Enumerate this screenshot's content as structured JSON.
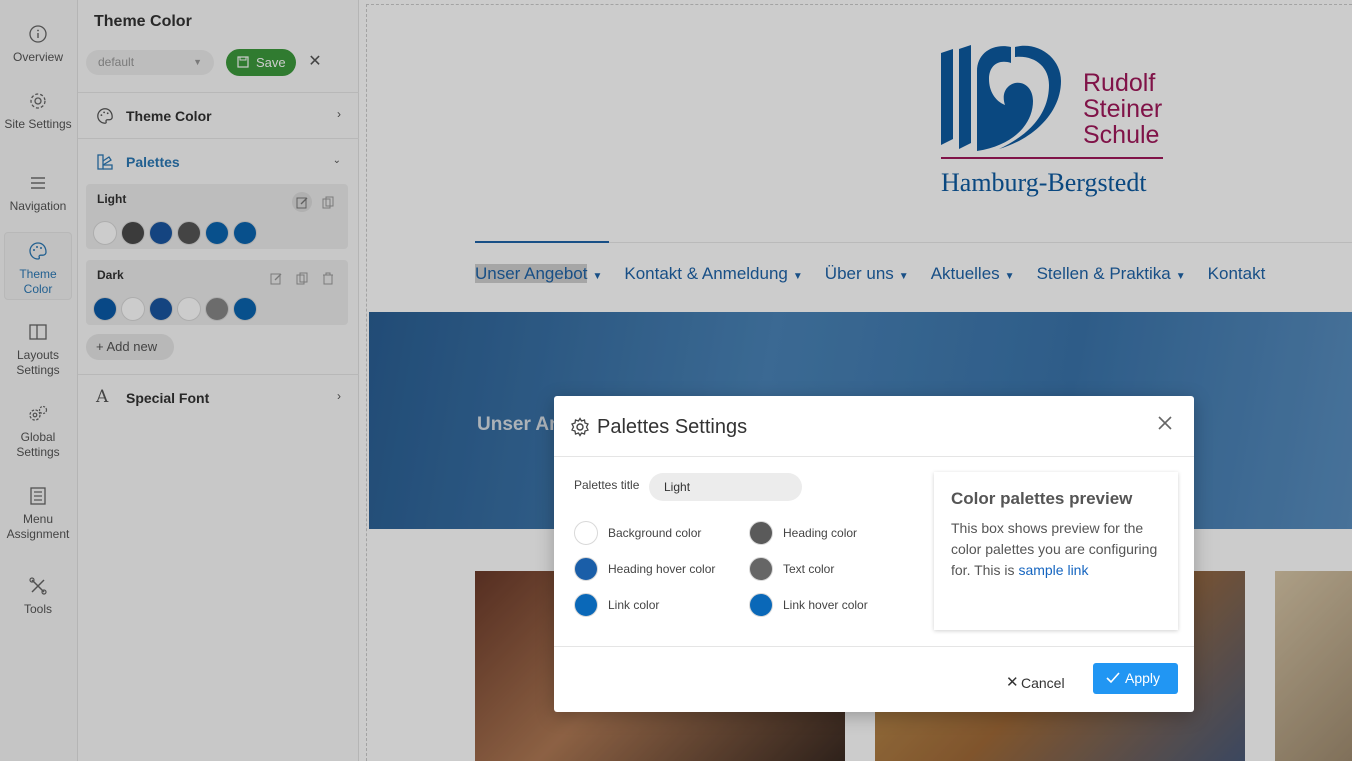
{
  "rail": {
    "items": [
      {
        "label": "Overview",
        "icon": "info-icon"
      },
      {
        "label": "Site Settings",
        "icon": "gear-icon"
      },
      {
        "label": "Navigation",
        "icon": "menu-icon"
      },
      {
        "label": "Theme Color",
        "icon": "palette-icon",
        "active": true
      },
      {
        "label": "Layouts Settings",
        "icon": "layout-icon"
      },
      {
        "label": "Global Settings",
        "icon": "gears-icon"
      },
      {
        "label": "Menu Assignment",
        "icon": "list-icon"
      },
      {
        "label": "Tools",
        "icon": "tools-icon"
      }
    ]
  },
  "panel": {
    "title": "Theme Color",
    "select_value": "default",
    "save_label": "Save",
    "sections": {
      "theme_color": "Theme Color",
      "palettes": "Palettes",
      "special_font": "Special Font"
    },
    "palettes": [
      {
        "name": "Light",
        "colors": [
          "#ffffff",
          "#4a4a4a",
          "#1a56a0",
          "#555555",
          "#0a64b0",
          "#0a64b0"
        ]
      },
      {
        "name": "Dark",
        "colors": [
          "#0a5aa8",
          "#ffffff",
          "#1a56a0",
          "#ffffff",
          "#888888",
          "#0a64b0"
        ]
      }
    ],
    "add_new_label": "Add new"
  },
  "site": {
    "logo": {
      "line1": "Rudolf",
      "line2": "Steiner",
      "line3": "Schule",
      "line4": "Hamburg-Bergstedt"
    },
    "nav": [
      "Unser Angebot",
      "Kontakt & Anmeldung",
      "Über uns",
      "Aktuelles",
      "Stellen & Praktika",
      "Kontakt"
    ],
    "hero_text": "Unser An"
  },
  "modal": {
    "title": "Palettes Settings",
    "palettes_title_label": "Palettes title",
    "palettes_title_value": "Light",
    "colors": [
      {
        "label": "Background color",
        "color": "#ffffff"
      },
      {
        "label": "Heading color",
        "color": "#5a5a5a"
      },
      {
        "label": "Heading hover color",
        "color": "#1a5ea8"
      },
      {
        "label": "Text color",
        "color": "#666666"
      },
      {
        "label": "Link color",
        "color": "#0a68b8"
      },
      {
        "label": "Link hover color",
        "color": "#0a68b8"
      }
    ],
    "preview": {
      "title": "Color palettes preview",
      "body": "This box shows preview for the color palettes you are configuring for. This is ",
      "link": "sample link"
    },
    "cancel_label": "Cancel",
    "apply_label": "Apply"
  },
  "colors": {
    "accent": "#2196f3",
    "save_green": "#3c9a3c",
    "brand_blue": "#1e63a8",
    "logo_magenta": "#a0185a"
  }
}
